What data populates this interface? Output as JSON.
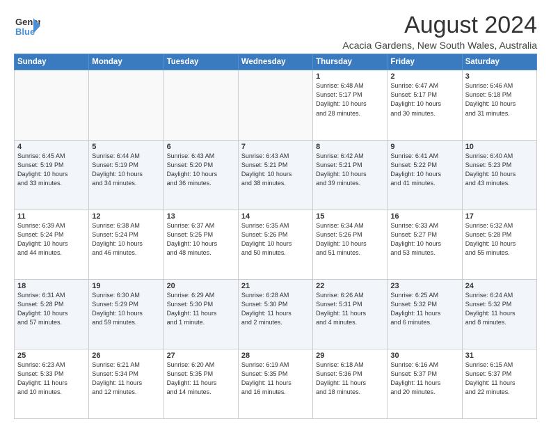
{
  "logo": {
    "line1": "General",
    "line2": "Blue",
    "icon": "▶"
  },
  "title": "August 2024",
  "subtitle": "Acacia Gardens, New South Wales, Australia",
  "days_of_week": [
    "Sunday",
    "Monday",
    "Tuesday",
    "Wednesday",
    "Thursday",
    "Friday",
    "Saturday"
  ],
  "weeks": [
    [
      {
        "day": "",
        "detail": ""
      },
      {
        "day": "",
        "detail": ""
      },
      {
        "day": "",
        "detail": ""
      },
      {
        "day": "",
        "detail": ""
      },
      {
        "day": "1",
        "detail": "Sunrise: 6:48 AM\nSunset: 5:17 PM\nDaylight: 10 hours\nand 28 minutes."
      },
      {
        "day": "2",
        "detail": "Sunrise: 6:47 AM\nSunset: 5:17 PM\nDaylight: 10 hours\nand 30 minutes."
      },
      {
        "day": "3",
        "detail": "Sunrise: 6:46 AM\nSunset: 5:18 PM\nDaylight: 10 hours\nand 31 minutes."
      }
    ],
    [
      {
        "day": "4",
        "detail": "Sunrise: 6:45 AM\nSunset: 5:19 PM\nDaylight: 10 hours\nand 33 minutes."
      },
      {
        "day": "5",
        "detail": "Sunrise: 6:44 AM\nSunset: 5:19 PM\nDaylight: 10 hours\nand 34 minutes."
      },
      {
        "day": "6",
        "detail": "Sunrise: 6:43 AM\nSunset: 5:20 PM\nDaylight: 10 hours\nand 36 minutes."
      },
      {
        "day": "7",
        "detail": "Sunrise: 6:43 AM\nSunset: 5:21 PM\nDaylight: 10 hours\nand 38 minutes."
      },
      {
        "day": "8",
        "detail": "Sunrise: 6:42 AM\nSunset: 5:21 PM\nDaylight: 10 hours\nand 39 minutes."
      },
      {
        "day": "9",
        "detail": "Sunrise: 6:41 AM\nSunset: 5:22 PM\nDaylight: 10 hours\nand 41 minutes."
      },
      {
        "day": "10",
        "detail": "Sunrise: 6:40 AM\nSunset: 5:23 PM\nDaylight: 10 hours\nand 43 minutes."
      }
    ],
    [
      {
        "day": "11",
        "detail": "Sunrise: 6:39 AM\nSunset: 5:24 PM\nDaylight: 10 hours\nand 44 minutes."
      },
      {
        "day": "12",
        "detail": "Sunrise: 6:38 AM\nSunset: 5:24 PM\nDaylight: 10 hours\nand 46 minutes."
      },
      {
        "day": "13",
        "detail": "Sunrise: 6:37 AM\nSunset: 5:25 PM\nDaylight: 10 hours\nand 48 minutes."
      },
      {
        "day": "14",
        "detail": "Sunrise: 6:35 AM\nSunset: 5:26 PM\nDaylight: 10 hours\nand 50 minutes."
      },
      {
        "day": "15",
        "detail": "Sunrise: 6:34 AM\nSunset: 5:26 PM\nDaylight: 10 hours\nand 51 minutes."
      },
      {
        "day": "16",
        "detail": "Sunrise: 6:33 AM\nSunset: 5:27 PM\nDaylight: 10 hours\nand 53 minutes."
      },
      {
        "day": "17",
        "detail": "Sunrise: 6:32 AM\nSunset: 5:28 PM\nDaylight: 10 hours\nand 55 minutes."
      }
    ],
    [
      {
        "day": "18",
        "detail": "Sunrise: 6:31 AM\nSunset: 5:28 PM\nDaylight: 10 hours\nand 57 minutes."
      },
      {
        "day": "19",
        "detail": "Sunrise: 6:30 AM\nSunset: 5:29 PM\nDaylight: 10 hours\nand 59 minutes."
      },
      {
        "day": "20",
        "detail": "Sunrise: 6:29 AM\nSunset: 5:30 PM\nDaylight: 11 hours\nand 1 minute."
      },
      {
        "day": "21",
        "detail": "Sunrise: 6:28 AM\nSunset: 5:30 PM\nDaylight: 11 hours\nand 2 minutes."
      },
      {
        "day": "22",
        "detail": "Sunrise: 6:26 AM\nSunset: 5:31 PM\nDaylight: 11 hours\nand 4 minutes."
      },
      {
        "day": "23",
        "detail": "Sunrise: 6:25 AM\nSunset: 5:32 PM\nDaylight: 11 hours\nand 6 minutes."
      },
      {
        "day": "24",
        "detail": "Sunrise: 6:24 AM\nSunset: 5:32 PM\nDaylight: 11 hours\nand 8 minutes."
      }
    ],
    [
      {
        "day": "25",
        "detail": "Sunrise: 6:23 AM\nSunset: 5:33 PM\nDaylight: 11 hours\nand 10 minutes."
      },
      {
        "day": "26",
        "detail": "Sunrise: 6:21 AM\nSunset: 5:34 PM\nDaylight: 11 hours\nand 12 minutes."
      },
      {
        "day": "27",
        "detail": "Sunrise: 6:20 AM\nSunset: 5:35 PM\nDaylight: 11 hours\nand 14 minutes."
      },
      {
        "day": "28",
        "detail": "Sunrise: 6:19 AM\nSunset: 5:35 PM\nDaylight: 11 hours\nand 16 minutes."
      },
      {
        "day": "29",
        "detail": "Sunrise: 6:18 AM\nSunset: 5:36 PM\nDaylight: 11 hours\nand 18 minutes."
      },
      {
        "day": "30",
        "detail": "Sunrise: 6:16 AM\nSunset: 5:37 PM\nDaylight: 11 hours\nand 20 minutes."
      },
      {
        "day": "31",
        "detail": "Sunrise: 6:15 AM\nSunset: 5:37 PM\nDaylight: 11 hours\nand 22 minutes."
      }
    ]
  ]
}
